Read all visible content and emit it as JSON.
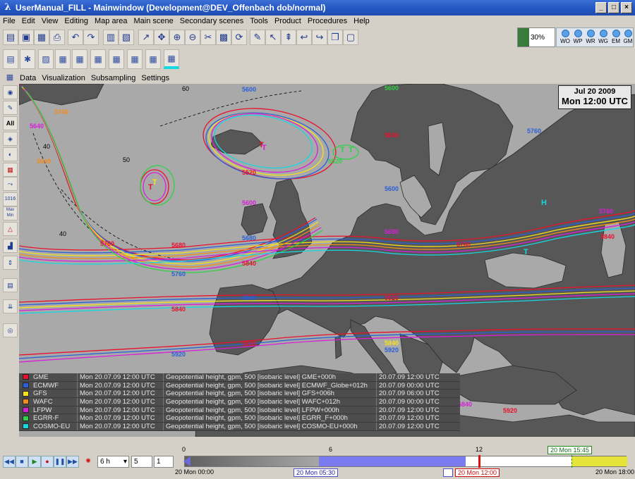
{
  "window": {
    "title": "UserManual_FILL - Mainwindow (Development@DEV_Offenbach dob/normal)",
    "controls": [
      "_",
      "□",
      "×"
    ]
  },
  "menu": [
    "File",
    "Edit",
    "View",
    "Editing",
    "Map area",
    "Main scene",
    "Secondary scenes",
    "Tools",
    "Product",
    "Procedures",
    "Help"
  ],
  "progress": {
    "value_percent": 30,
    "label": "30%"
  },
  "models": [
    "WO",
    "WP",
    "WR",
    "WG",
    "EM",
    "GM"
  ],
  "submenu": [
    "Data",
    "Visualization",
    "Subsampling",
    "Settings"
  ],
  "sidebar": {
    "all_label": "All",
    "val_label": "1016",
    "maxmin_label": "Max Min"
  },
  "map": {
    "date_line1": "Jul 20 2009",
    "date_line2": "Mon 12:00 UTC",
    "contour_labels": [
      "5600",
      "5760",
      "5640",
      "5640",
      "5600",
      "5600",
      "5760",
      "5600",
      "5520",
      "5520",
      "5600",
      "5680",
      "5680",
      "5760",
      "5680",
      "5760",
      "5760",
      "5840",
      "5840",
      "5760",
      "5840",
      "5840",
      "5920",
      "5920",
      "5920",
      "5840",
      "5920",
      "5920",
      "5840"
    ],
    "dashed_labels": [
      "60",
      "40",
      "50",
      "40"
    ]
  },
  "legend": [
    {
      "name": "GME",
      "color": "#e8112d",
      "time": "Mon 20.07.09 12:00 UTC",
      "desc": "Geopotential height, gpm, 500 [isobaric level] GME+000h",
      "valid": "20.07.09 12:00 UTC"
    },
    {
      "name": "ECMWF",
      "color": "#2a5fd6",
      "time": "Mon 20.07.09 12:00 UTC",
      "desc": "Geopotential height, gpm, 500 [isobaric level] ECMWF_Globe+012h",
      "valid": "20.07.09 00:00 UTC"
    },
    {
      "name": "GFS",
      "color": "#f5e21c",
      "time": "Mon 20.07.09 12:00 UTC",
      "desc": "Geopotential height, gpm, 500 [isobaric level] GFS+006h",
      "valid": "20.07.09 06:00 UTC"
    },
    {
      "name": "WAFC",
      "color": "#f28c1a",
      "time": "Mon 20.07.09 12:00 UTC",
      "desc": "Geopotential height, gpm, 500 [isobaric level] WAFC+012h",
      "valid": "20.07.09 00:00 UTC"
    },
    {
      "name": "LFPW",
      "color": "#d81ed8",
      "time": "Mon 20.07.09 12:00 UTC",
      "desc": "Geopotential height, gpm, 500 [isobaric level] LFPW+000h",
      "valid": "20.07.09 12:00 UTC"
    },
    {
      "name": "EGRR-F",
      "color": "#31d04a",
      "time": "Mon 20.07.09 12:00 UTC",
      "desc": "Geopotential height, gpm, 500 [isobaric level] EGRR_F+000h",
      "valid": "20.07.09 12:00 UTC"
    },
    {
      "name": "COSMO-EU",
      "color": "#16d8e0",
      "time": "Mon 20.07.09 12:00 UTC",
      "desc": "Geopotential height, gpm, 500 [isobaric level] COSMO-EU+000h",
      "valid": "20.07.09 12:00 UTC"
    }
  ],
  "timeline": {
    "step": "6 h",
    "spin1": "5",
    "spin2": "1",
    "ticks": [
      "0",
      "6",
      "12"
    ],
    "start_label": "20 Mon 00:00",
    "end_label": "20 Mon 18:00",
    "sel_start_label": "20 Mon 05:30",
    "current_label": "20 Mon 12:00",
    "right_label": "20 Mon 15:45",
    "current_fraction": 0.667
  }
}
